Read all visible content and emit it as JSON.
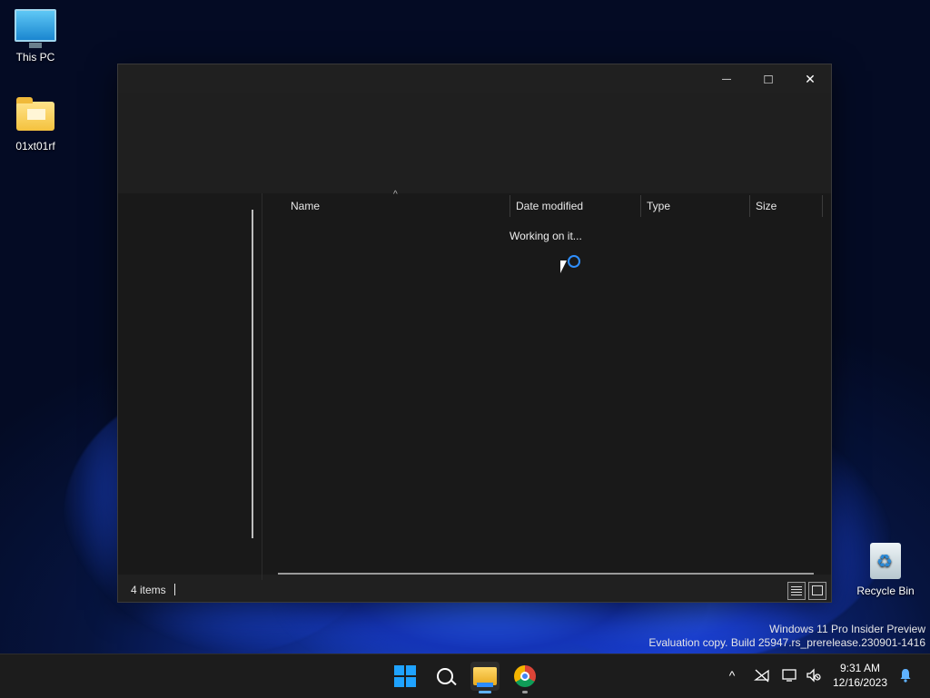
{
  "desktop": {
    "icons": [
      {
        "label": "This PC",
        "icon": "computer-icon"
      },
      {
        "label": "01xt01rf",
        "icon": "folder-icon"
      },
      {
        "label": "Recycle Bin",
        "icon": "recycle-bin-icon"
      }
    ],
    "watermark": {
      "line1": "Windows 11 Pro Insider Preview",
      "line2": "Evaluation copy. Build 25947.rs_prerelease.230901-1416"
    }
  },
  "explorer": {
    "controls": {
      "minimize": "—",
      "maximize": "□",
      "close": "✕"
    },
    "columns": [
      "Name",
      "Date modified",
      "Type",
      "Size"
    ],
    "sort_indicator": "^",
    "loading_text": "Working on it...",
    "status": {
      "item_count": "4 items"
    }
  },
  "taskbar": {
    "pinned": [
      {
        "name": "start",
        "icon": "windows-start-icon"
      },
      {
        "name": "search",
        "icon": "search-icon"
      },
      {
        "name": "file-explorer",
        "icon": "file-explorer-icon",
        "active": true
      },
      {
        "name": "chrome",
        "icon": "chrome-icon"
      }
    ],
    "tray": {
      "chevron": "^",
      "clock_time": "9:31 AM",
      "clock_date": "12/16/2023"
    }
  },
  "colors": {
    "accent": "#1fa3ff",
    "window_bg": "#202020",
    "taskbar_bg": "#1c1c1c"
  }
}
